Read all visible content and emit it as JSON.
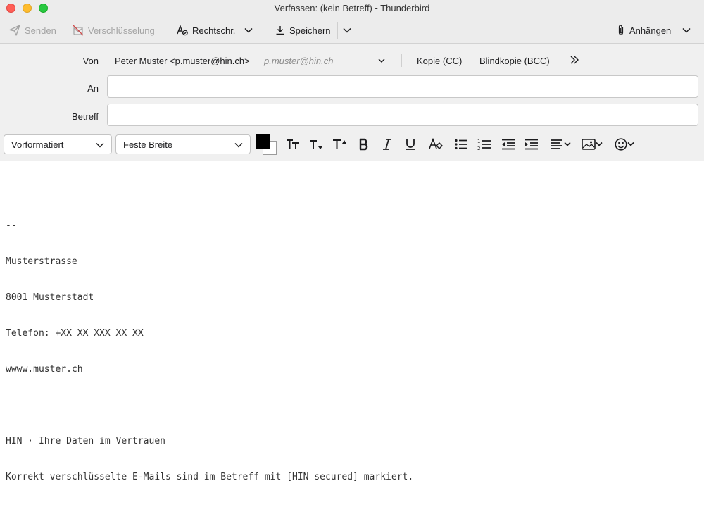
{
  "window": {
    "title": "Verfassen: (kein Betreff) - Thunderbird"
  },
  "toolbar": {
    "send_label": "Senden",
    "encryption_label": "Verschlüsselung",
    "spelling_label": "Rechtschr.",
    "save_label": "Speichern",
    "attach_label": "Anhängen"
  },
  "header": {
    "from_label": "Von",
    "from_value": "Peter Muster <p.muster@hin.ch>",
    "from_hint": "p.muster@hin.ch",
    "cc_label": "Kopie (CC)",
    "bcc_label": "Blindkopie (BCC)",
    "to_label": "An",
    "to_value": "",
    "subject_label": "Betreff",
    "subject_value": ""
  },
  "format": {
    "paragraph_style": "Vorformatiert",
    "font": "Feste Breite",
    "text_color": "#000000",
    "background_color": "#ffffff"
  },
  "body": {
    "signature_lines": [
      "--",
      "Musterstrasse",
      "8001 Musterstadt",
      "Telefon: +XX XX XXX XX XX",
      "wwww.muster.ch",
      "",
      "HIN · Ihre Daten im Vertrauen",
      "Korrekt verschlüsselte E-Mails sind im Betreff mit [HIN secured] markiert."
    ]
  }
}
